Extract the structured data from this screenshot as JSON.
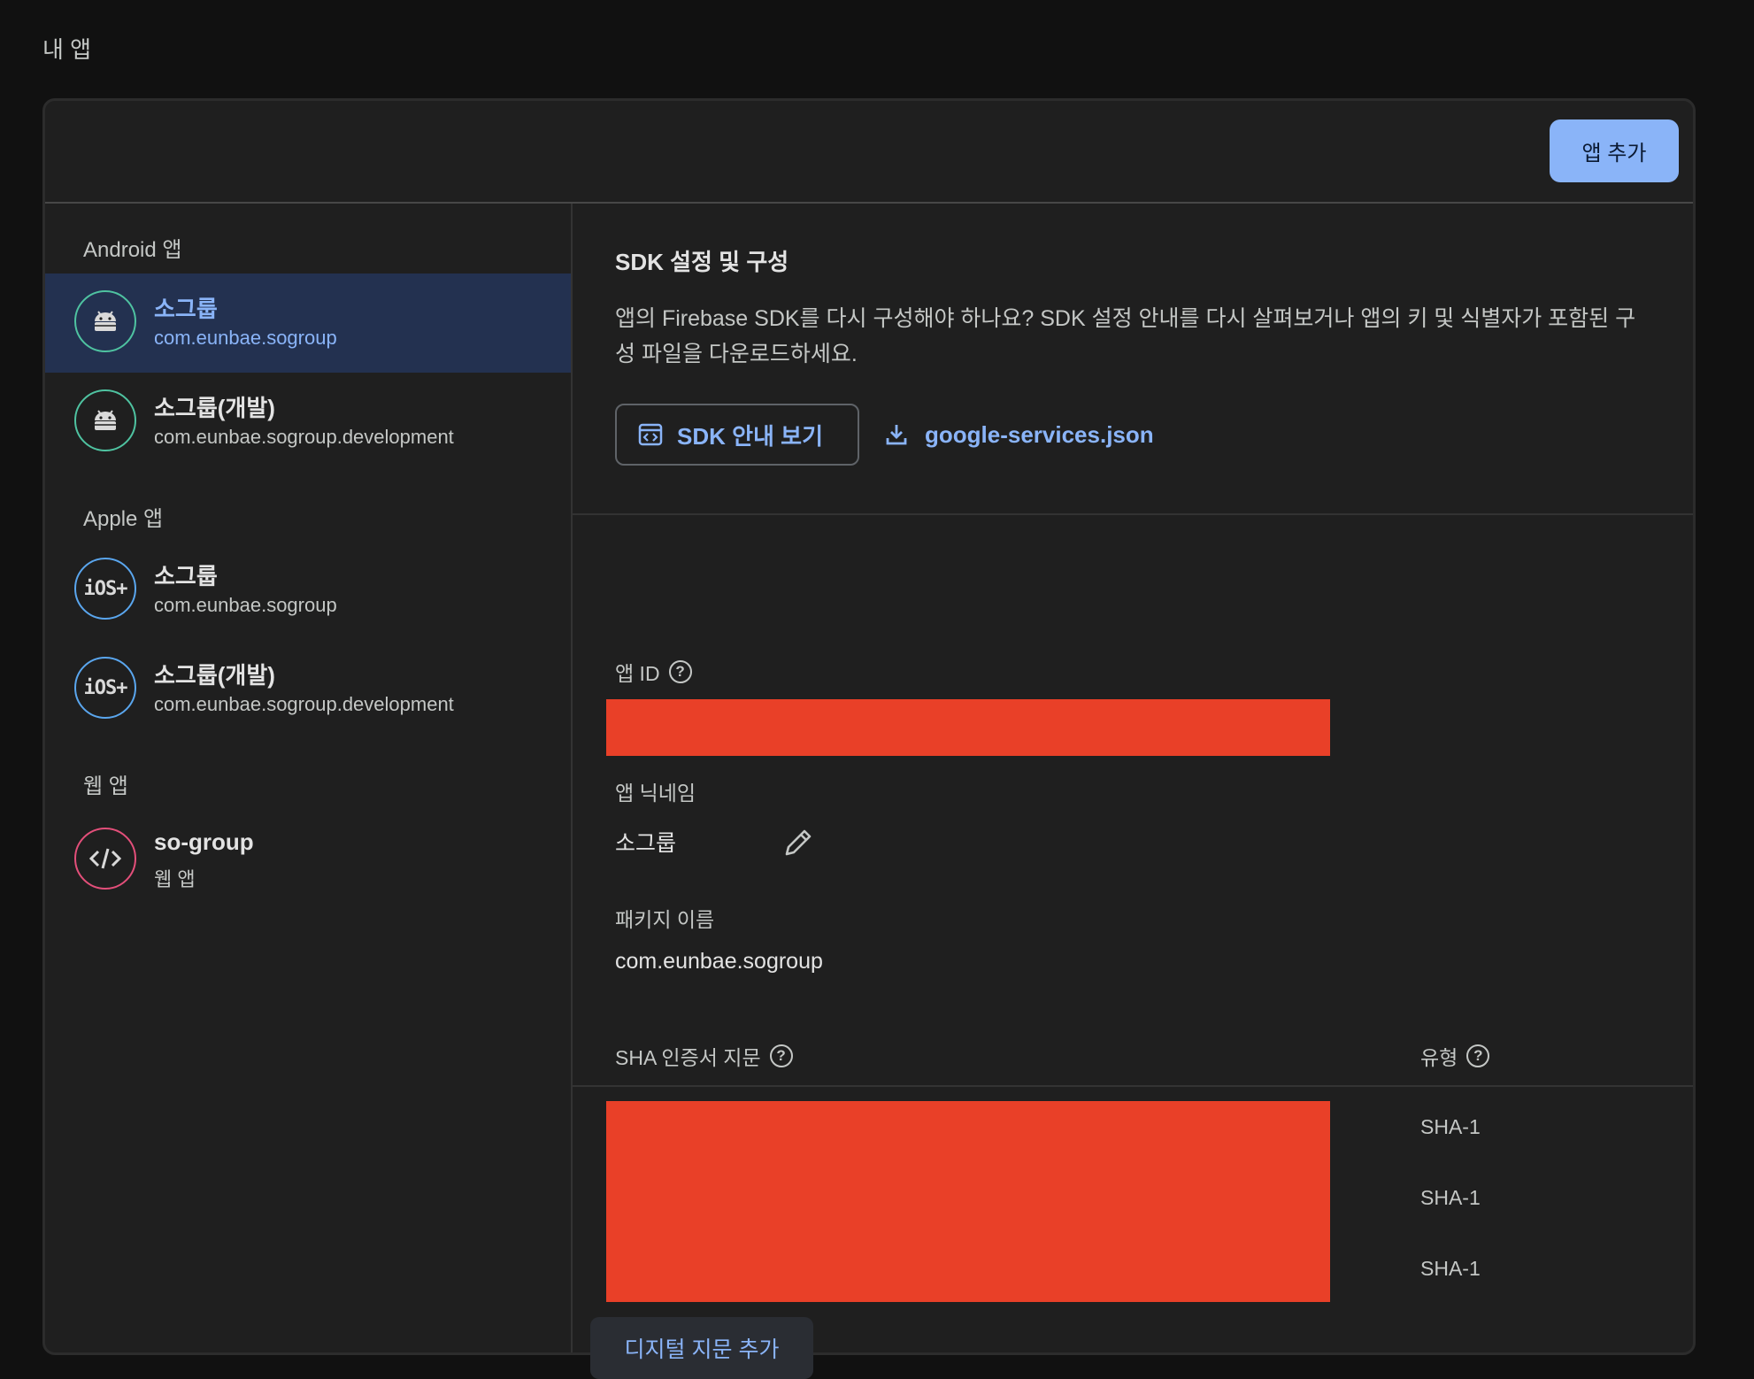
{
  "page": {
    "title": "내 앱"
  },
  "toolbar": {
    "add_app_label": "앱 추가"
  },
  "sidebar": {
    "sections": {
      "android": "Android 앱",
      "apple": "Apple 앱",
      "web": "웹 앱"
    },
    "items": [
      {
        "name": "소그룹",
        "sub": "com.eunbae.sogroup",
        "platform": "android",
        "selected": true
      },
      {
        "name": "소그룹(개발)",
        "sub": "com.eunbae.sogroup.development",
        "platform": "android"
      },
      {
        "name": "소그룹",
        "sub": "com.eunbae.sogroup",
        "platform": "ios"
      },
      {
        "name": "소그룹(개발)",
        "sub": "com.eunbae.sogroup.development",
        "platform": "ios"
      },
      {
        "name": "so-group",
        "sub": "웹 앱",
        "platform": "web"
      }
    ],
    "ios_badge": "iOS+"
  },
  "sdk": {
    "title": "SDK 설정 및 구성",
    "description": "앱의 Firebase SDK를 다시 구성해야 하나요? SDK 설정 안내를 다시 살펴보거나 앱의 키 및 식별자가 포함된 구성 파일을 다운로드하세요.",
    "guide_button": "SDK 안내 보기",
    "config_file": "google-services.json"
  },
  "details": {
    "app_id_label": "앱 ID",
    "nickname_label": "앱 닉네임",
    "nickname_value": "소그룹",
    "package_label": "패키지 이름",
    "package_value": "com.eunbae.sogroup",
    "sha_label": "SHA 인증서 지문",
    "type_label": "유형",
    "sha_types": [
      "SHA-1",
      "SHA-1",
      "SHA-1"
    ],
    "add_fingerprint": "디지털 지문 추가"
  },
  "colors": {
    "accent": "#8ab4f8",
    "selected_bg": "#233150",
    "redaction": "#e94028",
    "android_ring": "#4fc3a1",
    "ios_ring": "#5aa6ee",
    "web_ring": "#e34f7a"
  }
}
